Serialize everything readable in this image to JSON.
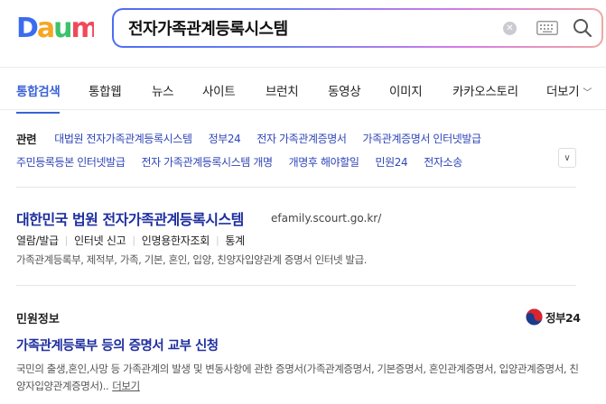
{
  "header": {
    "logo_text": "Daum",
    "search_query": "전자가족관계등록시스템"
  },
  "tabs": [
    "통합검색",
    "통합웹",
    "뉴스",
    "사이트",
    "브런치",
    "동영상",
    "이미지",
    "카카오스토리",
    "더보기"
  ],
  "related": {
    "label": "관련",
    "row1": [
      "대법원 전자가족관계등록시스템",
      "정부24",
      "전자 가족관계증명서",
      "가족관계증명서 인터넷발급"
    ],
    "row2": [
      "주민등록등본 인터넷발급",
      "전자 가족관계등록시스템 개명",
      "개명후 해야할일",
      "민원24",
      "전자소송"
    ]
  },
  "result1": {
    "title": "대한민국 법원 전자가족관계등록시스템",
    "url": "efamily.scourt.go.kr/",
    "sitelinks": [
      "열람/발급",
      "인터넷 신고",
      "인명용한자조회",
      "통계"
    ],
    "description": "가족관계등록부, 제적부, 가족, 기본, 혼인, 입양, 친양자입양관계 증명서 인터넷 발급."
  },
  "civil": {
    "section_title": "민원정보",
    "badge": "정부24",
    "title": "가족관계등록부 등의 증명서 교부 신청",
    "description": "국민의 출생,혼인,사망 등 가족관계의 발생 및 변동사항에 관한 증명서(가족관계증명서, 기본증명서, 혼인관계증명서, 입양관계증명서, 친양자입양관계증명서)..",
    "more_label": "더보기"
  }
}
